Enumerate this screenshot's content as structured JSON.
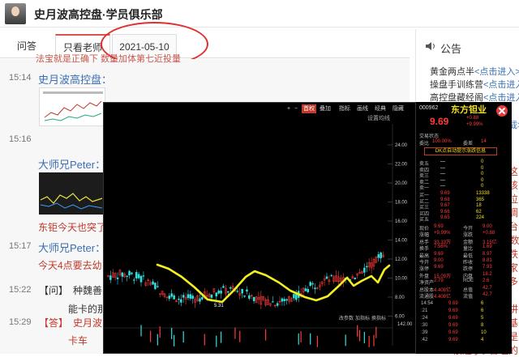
{
  "header": {
    "title": "史月波高控盘·学员俱乐部"
  },
  "tabs": [
    {
      "label": "问答"
    },
    {
      "label": "只看老师"
    },
    {
      "label": "2021-05-10"
    }
  ],
  "chat": {
    "clipped_top": "法宝就是正确下 数量加体第七近投量",
    "m1": {
      "time": "15:14",
      "name": "史月波高控盘："
    },
    "m2": {
      "time": "15:16",
      "name": "大师兄Peter：",
      "text": "东钜今天也突了"
    },
    "m3": {
      "time": "15:17",
      "name": "大师兄Peter：",
      "text": "今天4点要去幼"
    },
    "m4": {
      "time": "15:22",
      "tag": "【问】",
      "text": "种魏善",
      "reply": "能卡的那"
    },
    "m5": {
      "time": "15:29",
      "tag": "【答】",
      "text": "史月波",
      "reply": "卡车"
    }
  },
  "notice": {
    "title": "公告",
    "items": [
      {
        "text": "黄金两点半",
        "link": "<点击进入>"
      },
      {
        "text": "操盘手训练营",
        "link": "<点击进入>"
      },
      {
        "text": "高控盘藏经阁",
        "link": "<点击进入>"
      }
    ],
    "fragments": [
      "点击下载>",
      "，那这",
      "讲应该",
      "是高位",
      "也在调",
      "说茅台",
      "00点数",
      "现在跌",
      "让大家",
      "价是多",
      "也要",
      "上周讲",
      "术，基",
      "，但是",
      "合理的",
      "很远了。"
    ]
  },
  "chart_window": {
    "toolbar": [
      "+",
      "−",
      "首权",
      "叠加",
      "指标",
      "画线",
      "经典",
      "隐藏"
    ],
    "subtitle": "设置均线",
    "price_axis": [
      "24.00",
      "22.00",
      "20.00",
      "18.00",
      "16.00",
      "14.00",
      "12.00",
      "10.00",
      "8.00",
      "6.00"
    ],
    "low_label": "5.31",
    "vol_axis": "142.00",
    "bottom_tabs": [
      "改参数",
      "加指标",
      "换指标"
    ]
  },
  "quote_panel": {
    "code": "000962",
    "name": "东方钽业",
    "price": "9.69",
    "change": "+0.88",
    "change_pct": "+9.99%",
    "status_label": "交易状态",
    "ratio_label": "委比",
    "ratio_value": "100.00%",
    "diff_label": "委差",
    "diff_value": "14",
    "banner": "DK点自动提示涨跌信息",
    "sells": [
      {
        "label": "卖五",
        "price": "—",
        "vol": "0"
      },
      {
        "label": "卖四",
        "price": "—",
        "vol": "0"
      },
      {
        "label": "卖三",
        "price": "—",
        "vol": "0"
      },
      {
        "label": "卖二",
        "price": "—",
        "vol": "0"
      },
      {
        "label": "卖一",
        "price": "—",
        "vol": "0"
      }
    ],
    "buys": [
      {
        "label": "买一",
        "price": "9.69",
        "vol": "13338"
      },
      {
        "label": "买二",
        "price": "9.68",
        "vol": "365"
      },
      {
        "label": "买三",
        "price": "9.67",
        "vol": "18"
      },
      {
        "label": "买四",
        "price": "9.66",
        "vol": "62"
      },
      {
        "label": "买五",
        "price": "9.65",
        "vol": "224"
      }
    ],
    "stats": [
      {
        "l1": "现价",
        "v1": "9.69",
        "l2": "今开",
        "v2": "9.00"
      },
      {
        "l1": "涨幅",
        "v1": "+9.99%",
        "l2": "涨跌",
        "v2": "+0.88"
      },
      {
        "l1": "总手",
        "v1": "33.33万",
        "l2": "金额",
        "v2": "3.15亿"
      },
      {
        "l1": "换手",
        "v1": "7.56%",
        "l2": "量比",
        "v2": "1.69"
      },
      {
        "l1": "最高",
        "v1": "9.69",
        "l2": "最低",
        "v2": "8.97"
      },
      {
        "l1": "今开",
        "v1": "9.00",
        "l2": "昨收",
        "v2": "8.81"
      },
      {
        "l1": "涨停",
        "v1": "9.69",
        "l2": "跌停",
        "v2": "7.93"
      },
      {
        "l1": "外盘",
        "v1": "15.09万",
        "l2": "内盘",
        "v2": "18.2"
      },
      {
        "l1": "净资产",
        "v1": "2.79",
        "l2": "ROE",
        "v2": "2.6"
      },
      {
        "l1": "总股本",
        "v1": "4.408亿",
        "l2": "总值",
        "v2": "42.7"
      },
      {
        "l1": "流通股",
        "v1": "4.408亿",
        "l2": "流值",
        "v2": "42.7"
      }
    ],
    "ticks": [
      {
        "t": "14:54",
        "p": "9.69",
        "v": "6"
      },
      {
        "t": ":21",
        "p": "9.69",
        "v": "6"
      },
      {
        "t": ":24",
        "p": "9.69",
        "v": "5"
      },
      {
        "t": ":30",
        "p": "9.69",
        "v": "8"
      },
      {
        "t": ":39",
        "p": "9.69",
        "v": "10"
      },
      {
        "t": ":42",
        "p": "9.69",
        "v": "4"
      }
    ]
  }
}
